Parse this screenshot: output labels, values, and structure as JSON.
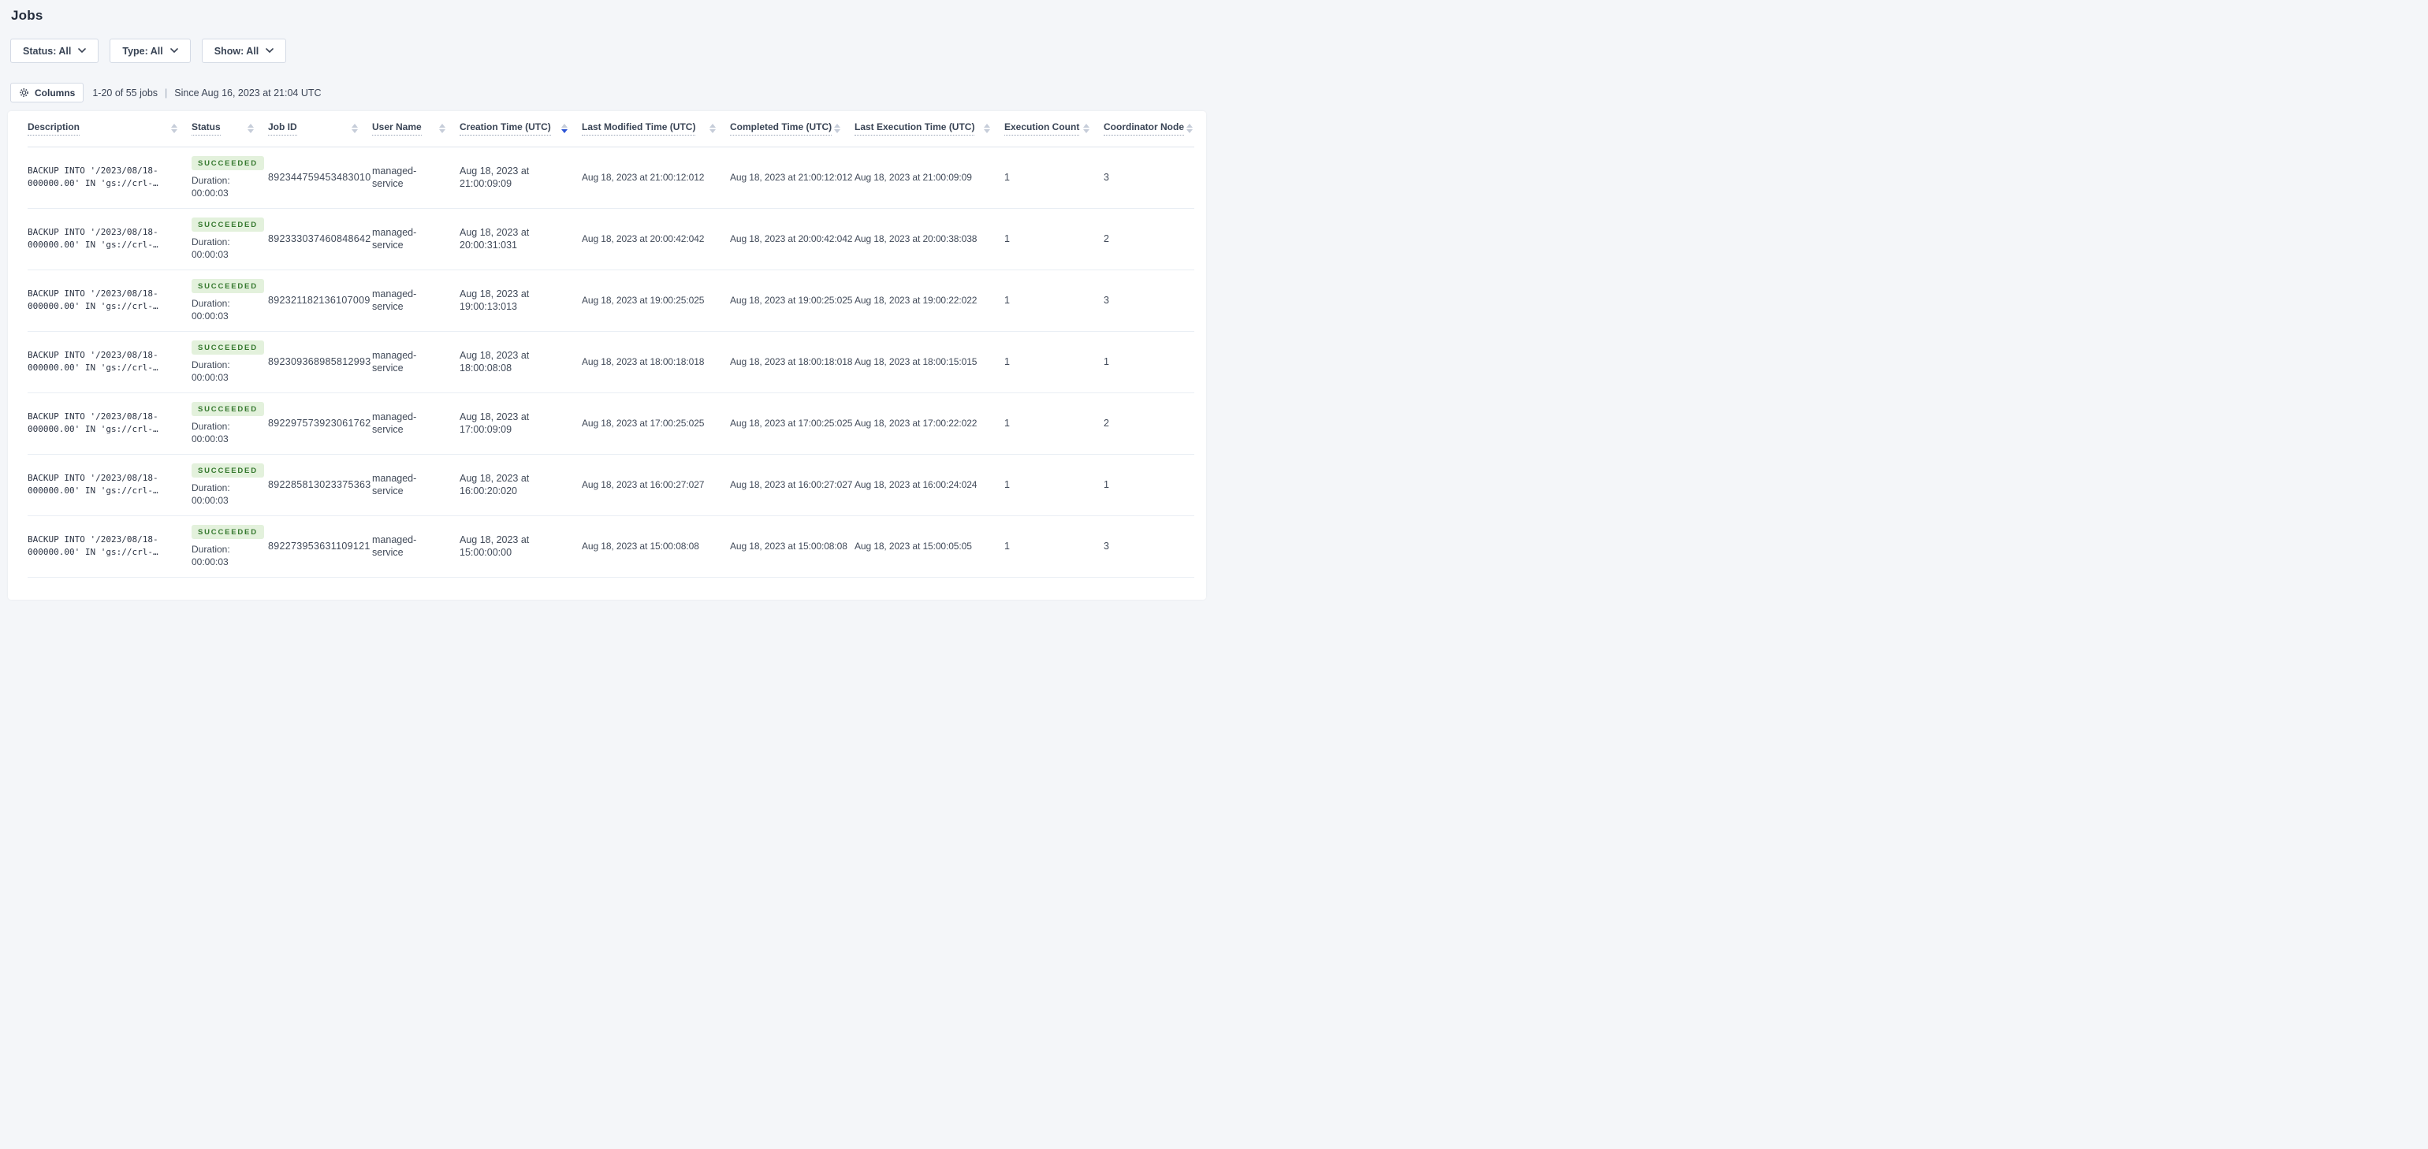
{
  "page": {
    "title": "Jobs",
    "background_color": "#f4f6f9"
  },
  "filters": [
    {
      "id": "status",
      "label": "Status: All"
    },
    {
      "id": "type",
      "label": "Type: All"
    },
    {
      "id": "show",
      "label": "Show: All"
    }
  ],
  "toolbar": {
    "columns_label": "Columns",
    "count": "1-20 of 55 jobs",
    "separator": "|",
    "since": "Since Aug 16, 2023 at 21:04 UTC"
  },
  "table": {
    "columns": [
      "Description",
      "Status",
      "Job ID",
      "User Name",
      "Creation Time (UTC)",
      "Last Modified Time (UTC)",
      "Completed Time (UTC)",
      "Last Execution Time (UTC)",
      "Execution Count",
      "Coordinator Node"
    ],
    "sorted_column": "Creation Time (UTC)",
    "sort_direction": "desc",
    "colors": {
      "badge_background": "#e3f1dc",
      "badge_text": "#36792f",
      "sort_active_arrow": "#2d55d5",
      "sort_inactive_arrow": "#c6cdd9"
    }
  },
  "rows": [
    {
      "description": "BACKUP INTO '/2023/08/18-\n000000.00' IN 'gs://crl-…",
      "status": "SUCCEEDED",
      "duration": "Duration:\n00:00:03",
      "job_id": "892344759453483010",
      "user_name": "managed-\nservice",
      "creation_time": "Aug 18, 2023 at\n21:00:09:09",
      "last_modified_time": "Aug 18, 2023 at 21:00:12:012",
      "completed_time": "Aug 18, 2023 at 21:00:12:012",
      "last_execution_time": "Aug 18, 2023 at 21:00:09:09",
      "execution_count": "1",
      "coordinator_node": "3"
    },
    {
      "description": "BACKUP INTO '/2023/08/18-\n000000.00' IN 'gs://crl-…",
      "status": "SUCCEEDED",
      "duration": "Duration:\n00:00:03",
      "job_id": "892333037460848642",
      "user_name": "managed-\nservice",
      "creation_time": "Aug 18, 2023 at\n20:00:31:031",
      "last_modified_time": "Aug 18, 2023 at 20:00:42:042",
      "completed_time": "Aug 18, 2023 at 20:00:42:042",
      "last_execution_time": "Aug 18, 2023 at 20:00:38:038",
      "execution_count": "1",
      "coordinator_node": "2"
    },
    {
      "description": "BACKUP INTO '/2023/08/18-\n000000.00' IN 'gs://crl-…",
      "status": "SUCCEEDED",
      "duration": "Duration:\n00:00:03",
      "job_id": "892321182136107009",
      "user_name": "managed-\nservice",
      "creation_time": "Aug 18, 2023 at\n19:00:13:013",
      "last_modified_time": "Aug 18, 2023 at 19:00:25:025",
      "completed_time": "Aug 18, 2023 at 19:00:25:025",
      "last_execution_time": "Aug 18, 2023 at 19:00:22:022",
      "execution_count": "1",
      "coordinator_node": "3"
    },
    {
      "description": "BACKUP INTO '/2023/08/18-\n000000.00' IN 'gs://crl-…",
      "status": "SUCCEEDED",
      "duration": "Duration:\n00:00:03",
      "job_id": "892309368985812993",
      "user_name": "managed-\nservice",
      "creation_time": "Aug 18, 2023 at\n18:00:08:08",
      "last_modified_time": "Aug 18, 2023 at 18:00:18:018",
      "completed_time": "Aug 18, 2023 at 18:00:18:018",
      "last_execution_time": "Aug 18, 2023 at 18:00:15:015",
      "execution_count": "1",
      "coordinator_node": "1"
    },
    {
      "description": "BACKUP INTO '/2023/08/18-\n000000.00' IN 'gs://crl-…",
      "status": "SUCCEEDED",
      "duration": "Duration:\n00:00:03",
      "job_id": "892297573923061762",
      "user_name": "managed-\nservice",
      "creation_time": "Aug 18, 2023 at\n17:00:09:09",
      "last_modified_time": "Aug 18, 2023 at 17:00:25:025",
      "completed_time": "Aug 18, 2023 at 17:00:25:025",
      "last_execution_time": "Aug 18, 2023 at 17:00:22:022",
      "execution_count": "1",
      "coordinator_node": "2"
    },
    {
      "description": "BACKUP INTO '/2023/08/18-\n000000.00' IN 'gs://crl-…",
      "status": "SUCCEEDED",
      "duration": "Duration:\n00:00:03",
      "job_id": "892285813023375363",
      "user_name": "managed-\nservice",
      "creation_time": "Aug 18, 2023 at\n16:00:20:020",
      "last_modified_time": "Aug 18, 2023 at 16:00:27:027",
      "completed_time": "Aug 18, 2023 at 16:00:27:027",
      "last_execution_time": "Aug 18, 2023 at 16:00:24:024",
      "execution_count": "1",
      "coordinator_node": "1"
    },
    {
      "description": "BACKUP INTO '/2023/08/18-\n000000.00' IN 'gs://crl-…",
      "status": "SUCCEEDED",
      "duration": "Duration:\n00:00:03",
      "job_id": "892273953631109121",
      "user_name": "managed-\nservice",
      "creation_time": "Aug 18, 2023 at\n15:00:00:00",
      "last_modified_time": "Aug 18, 2023 at 15:00:08:08",
      "completed_time": "Aug 18, 2023 at 15:00:08:08",
      "last_execution_time": "Aug 18, 2023 at 15:00:05:05",
      "execution_count": "1",
      "coordinator_node": "3"
    }
  ]
}
